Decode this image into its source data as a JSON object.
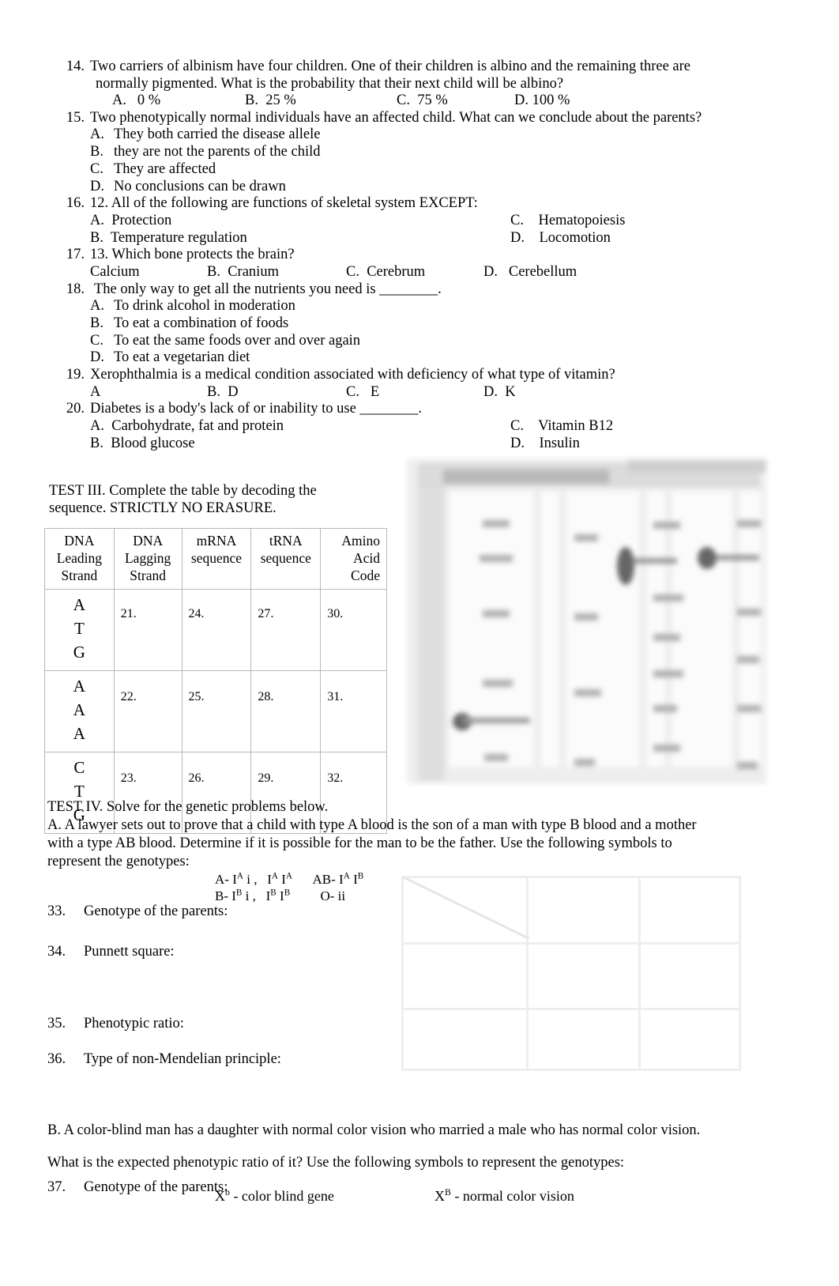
{
  "questions": [
    {
      "number": "14.",
      "text": "Two carriers of albinism have four children. One of their children is albino and the remaining three are",
      "cont": "normally pigmented. What is the probability that their next child will be albino?",
      "inline_options": [
        "A.   0 %",
        "B.  25 %",
        "C.  75 %",
        "D. 100 %"
      ]
    },
    {
      "number": "15.",
      "text": "Two phenotypically normal individuals have an affected child. What can we conclude about the parents?",
      "options": [
        {
          "label": "A.",
          "text": "They both carried the disease allele"
        },
        {
          "label": "B.",
          "text": "they are not the parents of the child"
        },
        {
          "label": "C.",
          "text": "They are affected"
        },
        {
          "label": "D.",
          "text": "No conclusions can be drawn"
        }
      ]
    },
    {
      "number": "16.",
      "text": "12. All of the following are functions of skeletal system EXCEPT:",
      "two_col": [
        {
          "left": "A.  Protection",
          "right": "C.    Hematopoiesis"
        },
        {
          "left": "B.  Temperature regulation",
          "right": "D.    Locomotion"
        }
      ]
    },
    {
      "number": "17.",
      "text": "13. Which bone protects the brain?",
      "inline_options": [
        "Calcium",
        "B.  Cranium",
        "C.  Cerebrum",
        "D.   Cerebellum"
      ]
    },
    {
      "number": "18.",
      "text": "The only way to get all the nutrients you need is ________.",
      "options": [
        {
          "label": "A.",
          "text": "To drink alcohol in moderation"
        },
        {
          "label": "B.",
          "text": "To eat a combination of foods"
        },
        {
          "label": "C.",
          "text": "To eat the same foods over and over again"
        },
        {
          "label": "D.",
          "text": "To eat a vegetarian diet"
        }
      ]
    },
    {
      "number": "19.",
      "text": "Xerophthalmia is a medical condition associated with deficiency of what type of vitamin?",
      "inline_options": [
        "A",
        "B.  D",
        "C.   E",
        "D.  K"
      ]
    },
    {
      "number": "20.",
      "text": "Diabetes is a body's lack of or inability to use ________.",
      "two_col": [
        {
          "left": "A.  Carbohydrate, fat and protein",
          "right": "C.    Vitamin B12"
        },
        {
          "left": "B.  Blood glucose",
          "right": "D.    Insulin"
        }
      ]
    }
  ],
  "test3": {
    "instruction_line1": "TEST III. Complete the table by decoding the",
    "instruction_line2": "sequence. STRICTLY NO ERASURE.",
    "headers": [
      "DNA\nLeading\nStrand",
      "DNA\nLagging\nStrand",
      "mRNA\nsequence",
      "tRNA\nsequence",
      "Amino\nAcid\nCode"
    ],
    "rows": [
      {
        "leading": "A\nT\nG",
        "lagging": "21.",
        "mrna": "24.",
        "trna": "27.",
        "amino": "30."
      },
      {
        "leading": "A\nA\nA",
        "lagging": "22.",
        "mrna": "25.",
        "trna": "28.",
        "amino": "31."
      },
      {
        "leading": "C\nT\nG",
        "lagging": "23.",
        "mrna": "26.",
        "trna": "29.",
        "amino": "32."
      }
    ],
    "figure_name": "genetic-code-codon-chart"
  },
  "test4": {
    "heading": "TEST IV. Solve for the genetic problems below.",
    "problem_a_line1": "A.  A lawyer sets out to prove that a child with type A blood is the son of a man with type B blood and a mother",
    "problem_a_line2": "with a type AB blood. Determine if it is possible for the man to be the father. Use the following symbols to",
    "problem_a_line3": "represent the genotypes:",
    "symbols_line1_left": "A- I",
    "symbols_line1": "A- IA i ,   IA IA        AB- IA IB",
    "symbols_line2": "B- IB i ,   IB IB            O- ii",
    "items": [
      {
        "number": "33.",
        "label": "Genotype of the parents:"
      },
      {
        "number": "34.",
        "label": "Punnett square:"
      },
      {
        "number": "35.",
        "label": "Phenotypic ratio:"
      },
      {
        "number": "36.",
        "label": "Type of non-Mendelian principle:"
      }
    ],
    "problem_b_line1": "B.  A color-blind man has a daughter with normal color vision who married a male who has normal color vision.",
    "problem_b_line2": "What is the expected phenotypic ratio of it? Use the following symbols to represent the genotypes:",
    "b_symbol_left": "Xb - color blind gene",
    "b_symbol_right": "XB - normal color vision",
    "item_37": {
      "number": "37.",
      "label": "Genotype of the parents:"
    }
  }
}
